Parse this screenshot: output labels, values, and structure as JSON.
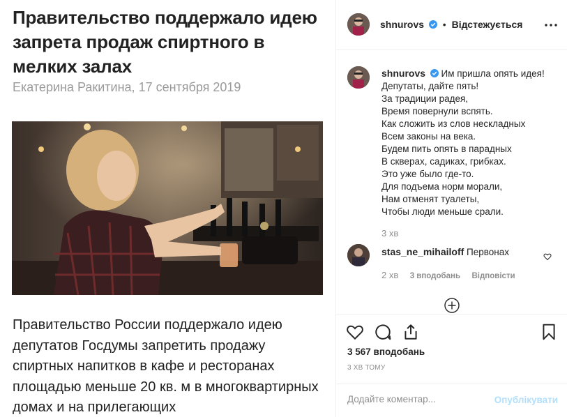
{
  "article": {
    "title": "Правительство поддержало идею запрета продаж спиртного в мелких залах",
    "byline": "Екатерина Ракитина, 17 сентября 2019",
    "photo_icon": "bartender-photo",
    "body": "Правительство России поддержало идею депутатов Госдумы запретить продажу спиртных напитков в кафе и ресторанах площадью меньше 20 кв. м в многоквартирных домах и на прилегающих"
  },
  "post": {
    "author": "shnurovs",
    "follow_status": "Відстежується",
    "caption_author": "shnurovs",
    "caption_lines": [
      "Им пришла опять идея!",
      "Депутаты, дайте пять!",
      "За традиции радея,",
      "Время повернули вспять.",
      "Как сложить из слов нескладных",
      "Всем законы на века.",
      "Будем пить опять в парадных",
      "В скверах, садиках, грибках.",
      "Это уже было где-то.",
      "Для подъема норм морали,",
      "Нам отменят туалеты,",
      "Чтобы люди меньше срали."
    ],
    "caption_time": "3 хв",
    "comment": {
      "author": "stas_ne_mihailoff",
      "text": "Первонах",
      "time": "2 хв",
      "likes": "3 вподобань",
      "reply": "Відповісти"
    },
    "likes": "3 567 вподобань",
    "time_ago": "3 ХВ ТОМУ",
    "comment_placeholder": "Додайте коментар...",
    "publish_label": "Опублікувати"
  },
  "colors": {
    "verified": "#3897f0",
    "publish_disabled": "#b2dffc",
    "meta": "#8e8e8e"
  }
}
